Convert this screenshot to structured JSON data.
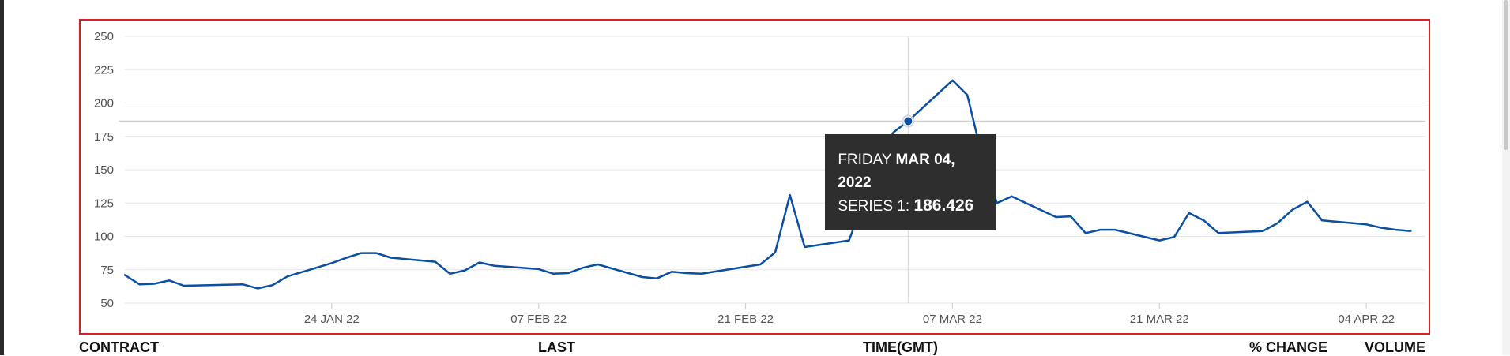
{
  "chart_data": {
    "type": "line",
    "x": [
      "2022-01-10",
      "2022-01-11",
      "2022-01-12",
      "2022-01-13",
      "2022-01-14",
      "2022-01-18",
      "2022-01-19",
      "2022-01-20",
      "2022-01-21",
      "2022-01-24",
      "2022-01-25",
      "2022-01-26",
      "2022-01-27",
      "2022-01-28",
      "2022-01-31",
      "2022-02-01",
      "2022-02-02",
      "2022-02-03",
      "2022-02-04",
      "2022-02-07",
      "2022-02-08",
      "2022-02-09",
      "2022-02-10",
      "2022-02-11",
      "2022-02-14",
      "2022-02-15",
      "2022-02-16",
      "2022-02-17",
      "2022-02-18",
      "2022-02-22",
      "2022-02-23",
      "2022-02-24",
      "2022-02-25",
      "2022-02-28",
      "2022-03-01",
      "2022-03-02",
      "2022-03-03",
      "2022-03-04",
      "2022-03-07",
      "2022-03-08",
      "2022-03-09",
      "2022-03-10",
      "2022-03-11",
      "2022-03-14",
      "2022-03-15",
      "2022-03-16",
      "2022-03-17",
      "2022-03-18",
      "2022-03-21",
      "2022-03-22",
      "2022-03-23",
      "2022-03-24",
      "2022-03-25",
      "2022-03-28",
      "2022-03-29",
      "2022-03-30",
      "2022-03-31",
      "2022-04-01",
      "2022-04-04",
      "2022-04-05",
      "2022-04-06",
      "2022-04-07"
    ],
    "series": [
      {
        "values": [
          71,
          64,
          64.5,
          67,
          63,
          64,
          61,
          63.5,
          70,
          80,
          84,
          87.5,
          87.5,
          84,
          81,
          72,
          74.5,
          80.5,
          78,
          75.5,
          72,
          72.5,
          76.5,
          79,
          69.5,
          68.5,
          73.5,
          72.5,
          72,
          79,
          88,
          131,
          92,
          97,
          127,
          155,
          178,
          186.426,
          217,
          206,
          160,
          125,
          130,
          114.5,
          115,
          102.5,
          105,
          105,
          97,
          99.5,
          117.5,
          112,
          102.5,
          104,
          110,
          120,
          126,
          112,
          109,
          106.5,
          105,
          104
        ]
      }
    ],
    "xticks": [
      {
        "date": "2022-01-24",
        "label": "24 JAN 22"
      },
      {
        "date": "2022-02-07",
        "label": "07 FEB 22"
      },
      {
        "date": "2022-02-21",
        "label": "21 FEB 22"
      },
      {
        "date": "2022-03-07",
        "label": "07 MAR 22"
      },
      {
        "date": "2022-03-21",
        "label": "21 MAR 22"
      },
      {
        "date": "2022-04-04",
        "label": "04 APR 22"
      }
    ],
    "yticks": [
      50,
      75,
      100,
      125,
      150,
      175,
      200,
      225,
      250
    ],
    "ylim": [
      50,
      250
    ],
    "xlim": [
      "2022-01-10",
      "2022-04-08"
    ],
    "title": "",
    "xlabel": "",
    "ylabel": "",
    "grid": true,
    "line_color": "#0a4fa3",
    "frame_color": "#d6202a",
    "highlight": {
      "date": "2022-03-04",
      "value": 186.426
    }
  },
  "tooltip": {
    "day": "FRIDAY",
    "date": "MAR 04,",
    "year": "2022",
    "series_label": "SERIES 1:",
    "value": "186.426"
  },
  "table": {
    "headers": [
      "CONTRACT",
      "LAST",
      "TIME(GMT)",
      "% CHANGE",
      "VOLUME"
    ]
  }
}
